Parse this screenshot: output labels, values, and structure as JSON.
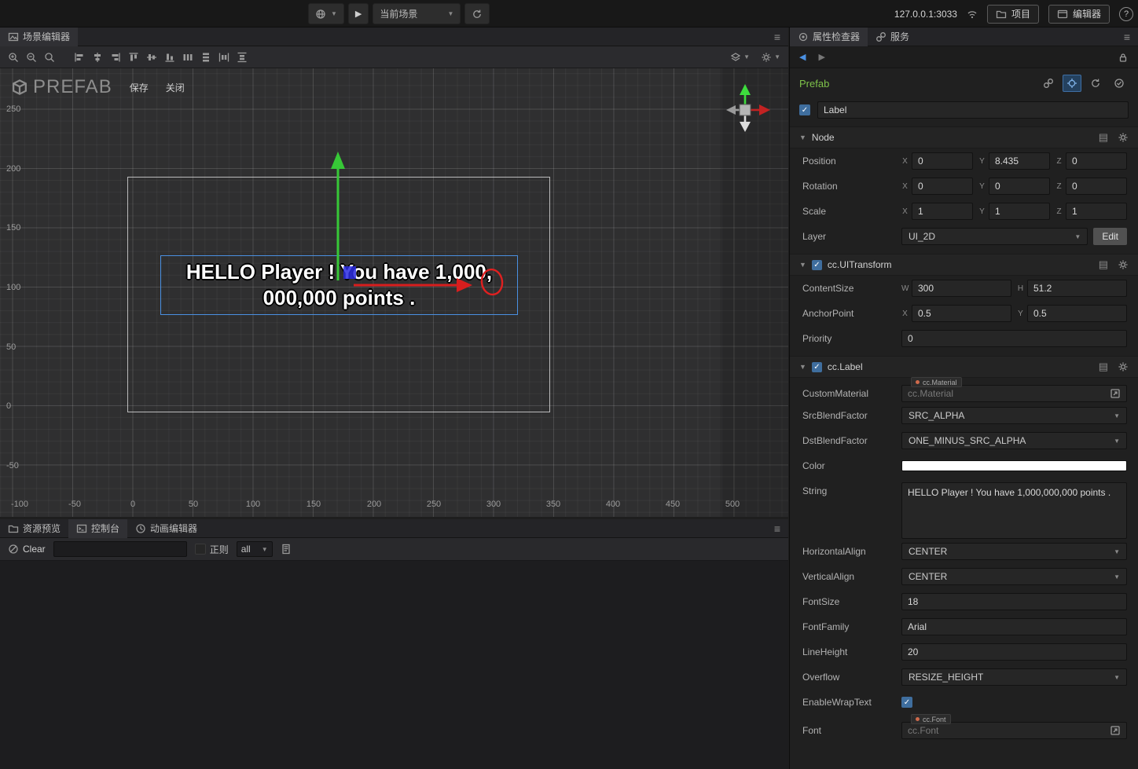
{
  "topbar": {
    "scene_select": "当前场景",
    "address": "127.0.0.1:3033",
    "project": "项目",
    "editor": "编辑器",
    "help": "?"
  },
  "scene": {
    "tab": "场景编辑器",
    "prefab_title": "PREFAB",
    "save": "保存",
    "close": "关闭",
    "label_line1": "HELLO Player ! You have 1,000,",
    "label_line2": "000,000 points .",
    "ruler_x": [
      "-100",
      "-50",
      "0",
      "50",
      "100",
      "150",
      "200",
      "250",
      "300",
      "350",
      "400",
      "450",
      "500"
    ],
    "ruler_y": [
      "250",
      "200",
      "150",
      "100",
      "50",
      "0",
      "-50"
    ]
  },
  "console": {
    "tabs": [
      "资源预览",
      "控制台",
      "动画编辑器"
    ],
    "clear": "Clear",
    "regex": "正则",
    "filter": "all"
  },
  "inspector": {
    "tabs": {
      "inspector": "属性检查器",
      "service": "服务"
    },
    "prefab": "Prefab",
    "node_name": "Label",
    "axis": {
      "x": "X",
      "y": "Y",
      "z": "Z",
      "w": "W",
      "h": "H"
    },
    "node": {
      "title": "Node",
      "position_label": "Position",
      "rotation_label": "Rotation",
      "scale_label": "Scale",
      "layer_label": "Layer",
      "position": {
        "x": "0",
        "y": "8.435",
        "z": "0"
      },
      "rotation": {
        "x": "0",
        "y": "0",
        "z": "0"
      },
      "scale": {
        "x": "1",
        "y": "1",
        "z": "1"
      },
      "layer": "UI_2D",
      "edit": "Edit"
    },
    "uitransform": {
      "title": "cc.UITransform",
      "contentsize_label": "ContentSize",
      "anchorpoint_label": "AnchorPoint",
      "priority_label": "Priority",
      "contentsize": {
        "w": "300",
        "h": "51.2"
      },
      "anchorpoint": {
        "x": "0.5",
        "y": "0.5"
      },
      "priority": "0"
    },
    "cclabel": {
      "title": "cc.Label",
      "custommaterial_label": "CustomMaterial",
      "custommaterial_chip": "cc.Material",
      "custommaterial_value": "cc.Material",
      "src_label": "SrcBlendFactor",
      "src": "SRC_ALPHA",
      "dst_label": "DstBlendFactor",
      "dst": "ONE_MINUS_SRC_ALPHA",
      "color_label": "Color",
      "color_value": "#FFFFFF",
      "string_label": "String",
      "string": "HELLO Player ! You have 1,000,000,000 points .",
      "halign_label": "HorizontalAlign",
      "halign": "CENTER",
      "valign_label": "VerticalAlign",
      "valign": "CENTER",
      "fontsize_label": "FontSize",
      "fontsize": "18",
      "fontfamily_label": "FontFamily",
      "fontfamily": "Arial",
      "lineheight_label": "LineHeight",
      "lineheight": "20",
      "overflow_label": "Overflow",
      "overflow": "RESIZE_HEIGHT",
      "wrap_label": "EnableWrapText",
      "font_label": "Font",
      "font_chip": "cc.Font",
      "font_value": "cc.Font"
    }
  }
}
